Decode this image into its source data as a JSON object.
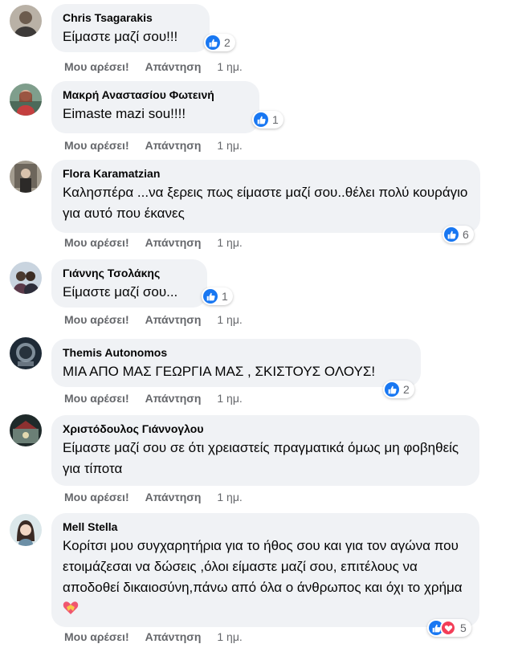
{
  "comments": [
    {
      "author": "Chris Tsagarakis",
      "text": "Είμαστε μαζί σου!!!",
      "like": "Μου αρέσει!",
      "reply": "Απάντηση",
      "time": "1 ημ.",
      "reactions": "2"
    },
    {
      "author": "Μακρή Αναστασίου Φωτεινή",
      "text": "Eimaste mazi sou!!!!",
      "like": "Μου αρέσει!",
      "reply": "Απάντηση",
      "time": "1 ημ.",
      "reactions": "1"
    },
    {
      "author": "Flora Karamatzian",
      "text": "Καλησπέρα ...να ξερεις πως είμαστε μαζί σου..θέλει πολύ κουράγιο για αυτό που έκανες",
      "like": "Μου αρέσει!",
      "reply": "Απάντηση",
      "time": "1 ημ.",
      "reactions": "6"
    },
    {
      "author": "Γιάννης Τσολάκης",
      "text": "Είμαστε μαζί σου...",
      "like": "Μου αρέσει!",
      "reply": "Απάντηση",
      "time": "1 ημ.",
      "reactions": "1"
    },
    {
      "author": "Themis Autonomos",
      "text": "ΜΙΑ ΑΠΟ ΜΑΣ ΓΕΩΡΓΙΑ ΜΑΣ , ΣΚΙΣΤΟΥΣ ΟΛΟΥΣ!",
      "like": "Μου αρέσει!",
      "reply": "Απάντηση",
      "time": "1 ημ.",
      "reactions": "2"
    },
    {
      "author": "Χριστόδουλος Γιάννογλου",
      "text": "Είμαστε μαζί σου σε ότι χρειαστείς πραγματικά όμως μη φοβηθείς για τίποτα",
      "like": "Μου αρέσει!",
      "reply": "Απάντηση",
      "time": "1 ημ."
    },
    {
      "author": "Mell Stella",
      "text": "Κορίτσι μου συγχαρητήρια για το ήθος σου και για τον αγώνα που ετοιμάζεσαι να δώσεις ,όλοι είμαστε μαζί σου, επιτέλους να αποδοθεί δικαιοσύνη,πάνω από όλα ο άνθρωπος και όχι το χρήμα",
      "like": "Μου αρέσει!",
      "reply": "Απάντηση",
      "time": "1 ημ.",
      "reactions": "5"
    }
  ],
  "colors": {
    "bubble": "#f0f2f5",
    "like_blue": "#1877f2",
    "love_red": "#f33e58",
    "meta_gray": "#65676b"
  },
  "icons": {
    "like": "like-thumb-icon",
    "love": "love-heart-icon",
    "emoji": "heart-with-ribbon-icon"
  }
}
